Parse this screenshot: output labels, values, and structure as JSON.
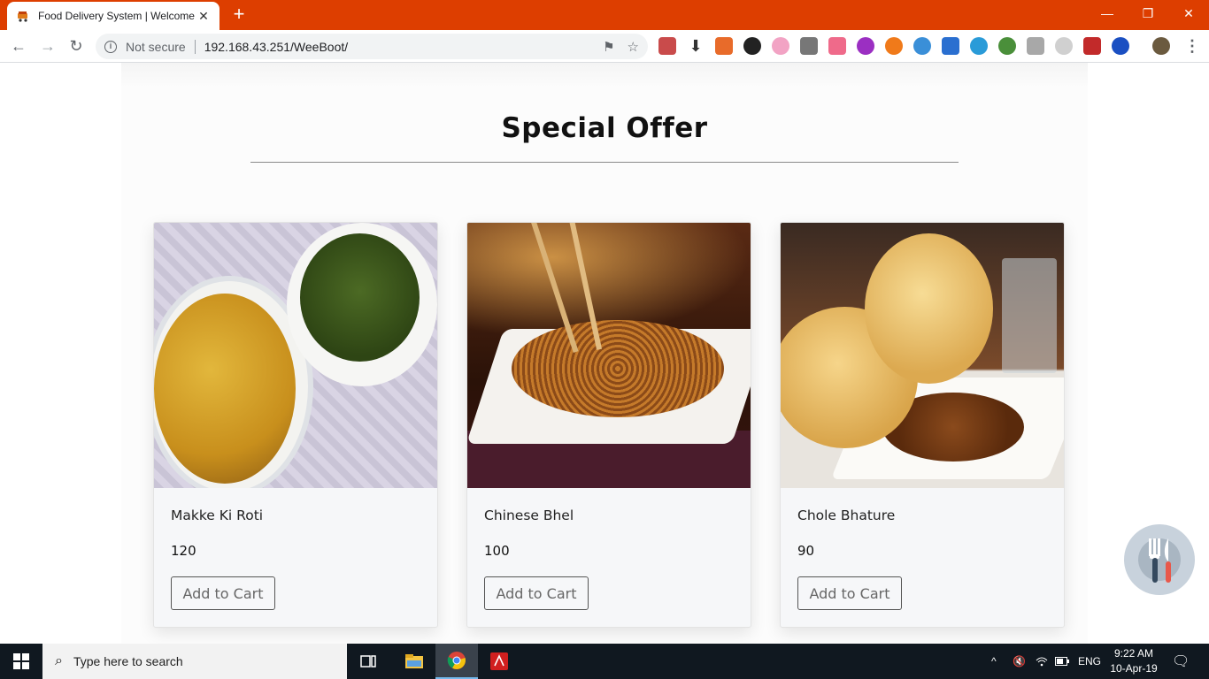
{
  "browser": {
    "tab_title": "Food Delivery System | Welcome",
    "security_label": "Not secure",
    "url": "192.168.43.251/WeeBoot/"
  },
  "page": {
    "section_title": "Special Offer",
    "offers": [
      {
        "name": "Makke Ki Roti",
        "price": "120",
        "button_label": "Add to Cart",
        "image": "makke-ki-roti-photo"
      },
      {
        "name": "Chinese Bhel",
        "price": "100",
        "button_label": "Add to Cart",
        "image": "chinese-bhel-photo"
      },
      {
        "name": "Chole Bhature",
        "price": "90",
        "button_label": "Add to Cart",
        "image": "chole-bhature-photo"
      }
    ]
  },
  "taskbar": {
    "search_placeholder": "Type here to search",
    "language": "ENG",
    "time": "9:22 AM",
    "date": "10-Apr-19"
  },
  "colors": {
    "tab_strip": "#dd3e00",
    "taskbar": "#101820",
    "card_bg": "#f6f7f9"
  }
}
